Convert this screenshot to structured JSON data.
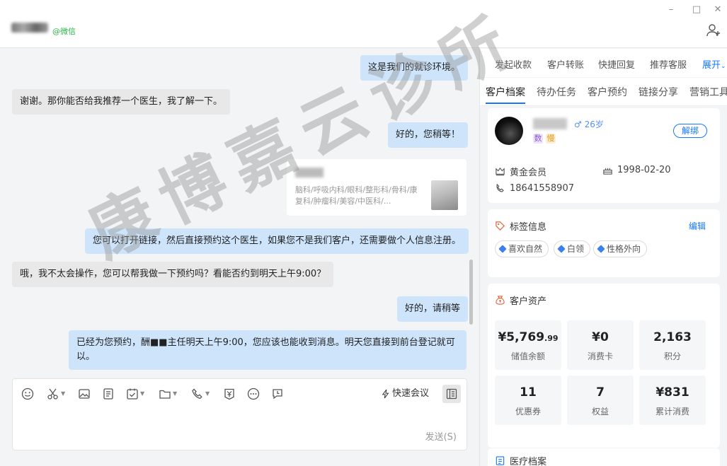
{
  "titlebar": {
    "contact_source": "@微信",
    "minimize": "–",
    "maximize": "□",
    "close": "✕"
  },
  "chat": {
    "messages": [
      {
        "dir": "out",
        "text": "这是我们的就诊环境。"
      },
      {
        "dir": "in",
        "text": "谢谢。那你能否给我推荐一个医生，我了解一下。"
      },
      {
        "dir": "out",
        "text": "好的，您稍等！"
      },
      {
        "dir": "out",
        "text": "您可以打开链接，然后直接预约这个医生，如果您不是我们客户，还需要做个人信息注册。"
      },
      {
        "dir": "in",
        "text": "哦，我不太会操作，您可以帮我做一下预约吗？看能否约到明天上午9:00？"
      },
      {
        "dir": "out",
        "text": "好的，请稍等"
      },
      {
        "dir": "out",
        "text": "已经为您预约，酬■■主任明天上午9:00，您应该也能收到消息。明天您直接到前台登记就可以。"
      }
    ],
    "link_card": {
      "desc": "脑科/呼吸内科/眼科/整形科/骨科/康复科/肿瘤科/美容/中医科/..."
    }
  },
  "composer": {
    "tools": [
      "emoji-icon",
      "scissors-icon",
      "image-icon",
      "document-icon",
      "task-icon",
      "folder-icon",
      "phone-icon",
      "payment-icon",
      "more-icon",
      "schedule-icon"
    ],
    "quick_meeting": "快速会议",
    "send": "发送(S)"
  },
  "right_panel": {
    "actions": [
      "发起收款",
      "客户转账",
      "快捷回复",
      "推荐客服",
      "展开"
    ],
    "tabs": [
      "客户档案",
      "待办任务",
      "客户预约",
      "链接分享",
      "营销工具"
    ],
    "active_tab": "客户档案",
    "profile": {
      "gender_age": "♂ 26岁",
      "badges": [
        "数",
        "慢"
      ],
      "unbind": "解绑",
      "membership": "黄金会员",
      "birthday": "1998-02-20",
      "phone": "18641558907"
    },
    "tags_section": {
      "title": "标签信息",
      "edit": "编辑",
      "tags": [
        "喜欢自然",
        "白领",
        "性格外向"
      ]
    },
    "assets_section": {
      "title": "客户资产",
      "items": [
        {
          "value": "¥5,769",
          "decimal": ".99",
          "label": "储值余额"
        },
        {
          "value": "¥0",
          "decimal": "",
          "label": "消费卡"
        },
        {
          "value": "2,163",
          "decimal": "",
          "label": "积分"
        },
        {
          "value": "11",
          "decimal": "",
          "label": "优惠券"
        },
        {
          "value": "7",
          "decimal": "",
          "label": "权益"
        },
        {
          "value": "¥831",
          "decimal": "",
          "label": "累计消费"
        }
      ]
    },
    "medical_section": {
      "title": "医疗档案"
    }
  },
  "watermark": "康博嘉云诊所",
  "colors": {
    "accent": "#1677ff",
    "bubble_out": "#cde4fb",
    "bubble_in": "#e8e8e8",
    "wechat_green": "#2bb34a"
  }
}
